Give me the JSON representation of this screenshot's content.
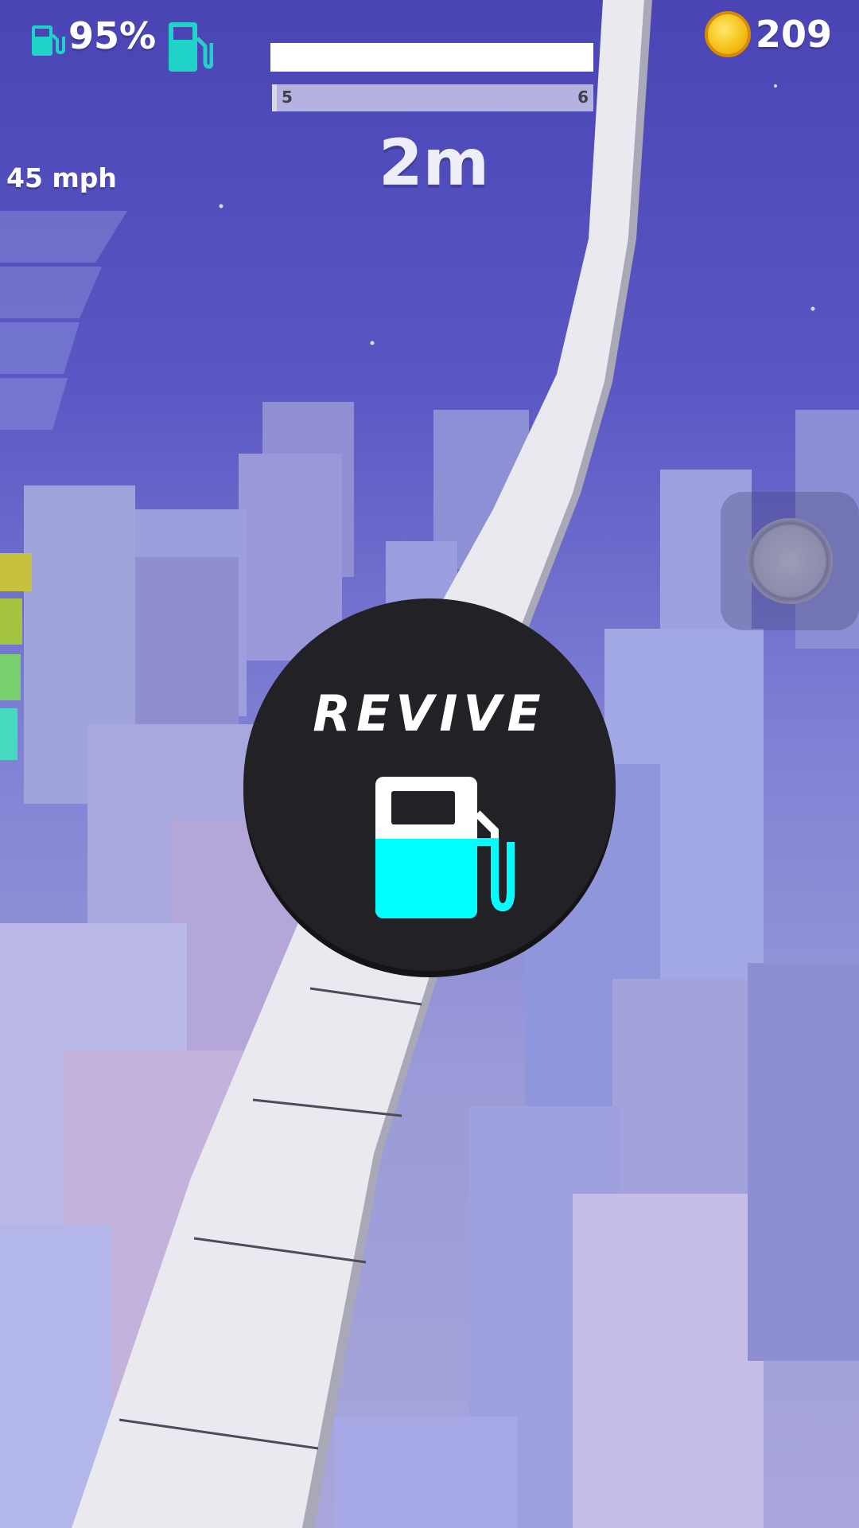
{
  "hud": {
    "fuel_percent": "95%",
    "speed": "45 mph",
    "coins": "209",
    "distance": "2m",
    "level_current": "5",
    "level_next": "6",
    "level_progress": 1.0
  },
  "revive": {
    "label": "REVIVE"
  },
  "icons": {
    "fuel": "fuel-pump-icon",
    "coin": "coin-icon",
    "joystick": "joystick-icon"
  },
  "colors": {
    "fuel_cyan": "#00ffff",
    "hud_teal": "#1fd3c8",
    "coin_gold": "#f6c21a",
    "revive_bg": "#222226"
  }
}
